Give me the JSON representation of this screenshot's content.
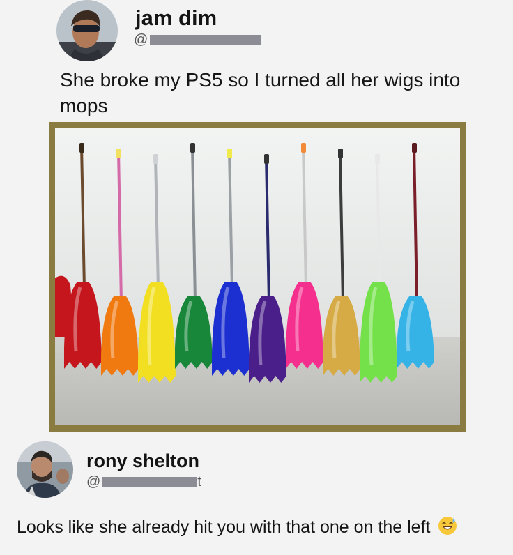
{
  "post": {
    "author_name": "jam dim",
    "handle_prefix": "@",
    "text": "She broke my PS5 so I turned all her wigs into mops"
  },
  "reply": {
    "author_name": "rony shelton",
    "handle_prefix": "@",
    "handle_suffix": "t",
    "text": "Looks like she already hit you with that one on the left",
    "emoji": "sweat-smile-emoji"
  },
  "photo": {
    "mop_colors": [
      "#c4161c",
      "#f07a10",
      "#f2df22",
      "#18873a",
      "#1c2fd0",
      "#4b1f8a",
      "#f52f8e",
      "#d6ab45",
      "#74e04a",
      "#35b3e6"
    ],
    "frame_color": "#8a7b41"
  }
}
